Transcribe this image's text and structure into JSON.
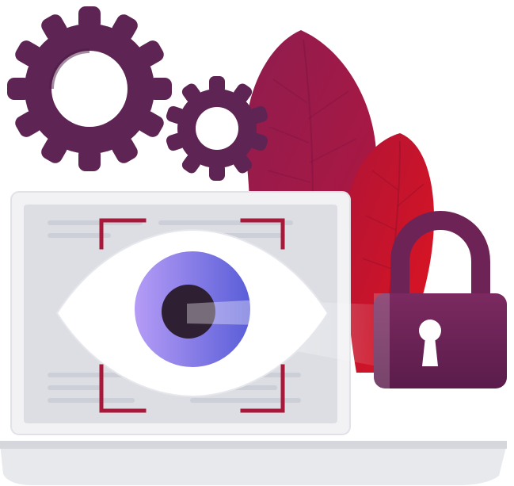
{
  "illustration": {
    "icons": [
      "gear-icon",
      "gear-icon",
      "leaf-shape",
      "leaf-shape",
      "laptop-icon",
      "eye-icon",
      "scan-frame-icon",
      "padlock-icon",
      "keyhole-icon"
    ],
    "colors": {
      "gear": "#5e2554",
      "gear_dark": "#4a1a43",
      "leaf_back": "#9b1b4b",
      "leaf_front": "#c4102b",
      "laptop_frame": "#f0f0f3",
      "laptop_screen": "#d9dbe1",
      "laptop_base": "#e6e7eb",
      "scan_corner": "#a8183a",
      "iris_light": "#a48ef0",
      "iris_dark": "#5f5fd6",
      "pupil": "#2e1f33",
      "lock_body": "#6e2357",
      "lock_shackle": "#7a2a5f",
      "keyhole": "#ffffff"
    }
  }
}
